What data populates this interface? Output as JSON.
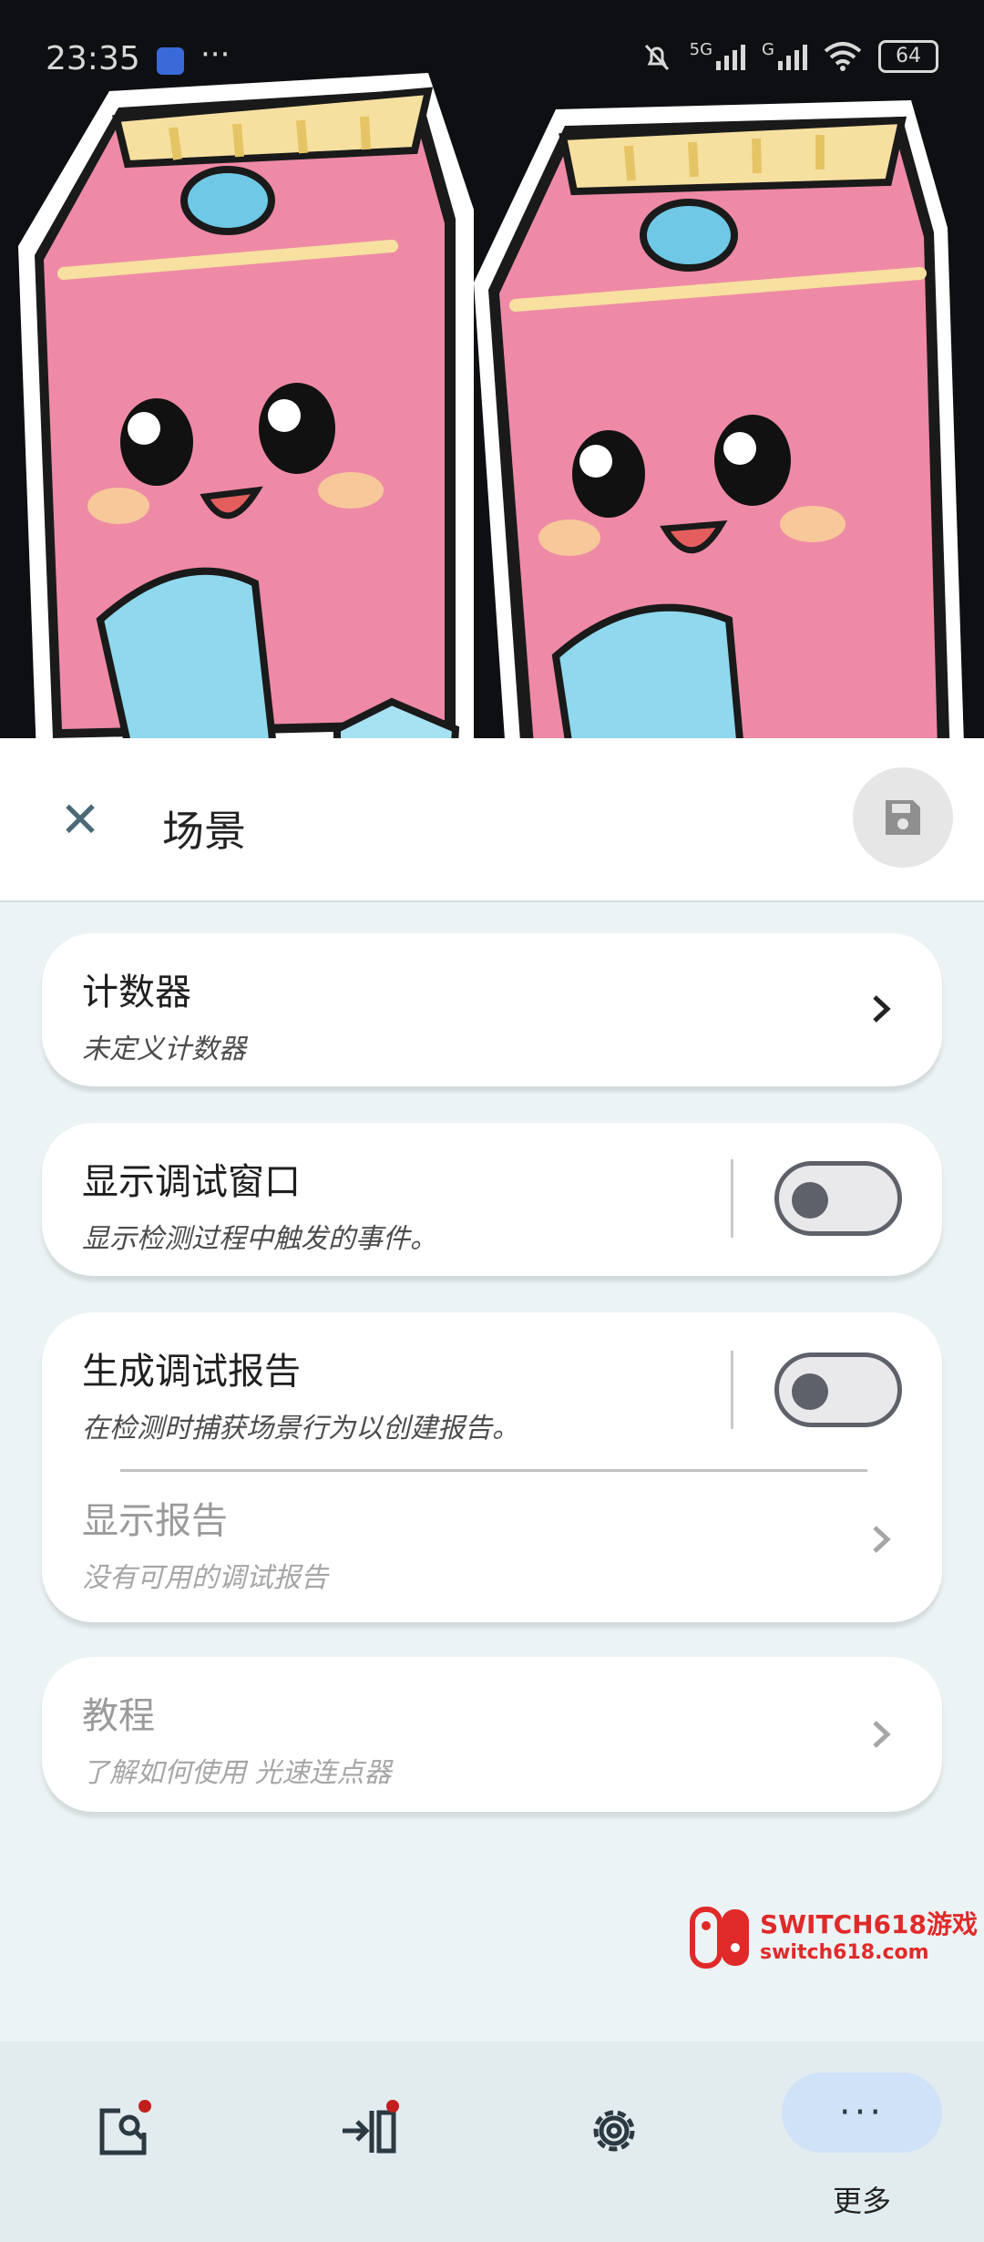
{
  "status_bar": {
    "time": "23:35",
    "more_dots": "···",
    "net_1": "5G",
    "net_2": "G",
    "battery": "64"
  },
  "header": {
    "title": "场景",
    "close_icon": "close-icon",
    "save_icon": "save-icon"
  },
  "cards": {
    "counter": {
      "title": "计数器",
      "subtitle": "未定义计数器"
    },
    "debug_window": {
      "title": "显示调试窗口",
      "subtitle": "显示检测过程中触发的事件。",
      "enabled": false
    },
    "debug_report": {
      "title": "生成调试报告",
      "subtitle": "在检测时捕获场景行为以创建报告。",
      "enabled": false
    },
    "show_report": {
      "title": "显示报告",
      "subtitle": "没有可用的调试报告"
    },
    "tutorial": {
      "title": "教程",
      "subtitle": "了解如何使用 光速连点器"
    }
  },
  "watermark": {
    "main": "SWITCH618游戏",
    "sub": "switch618.com"
  },
  "bottom_nav": {
    "more_dots": "···",
    "more_label": "更多"
  },
  "colors": {
    "accent_pill": "#cfe2f7",
    "badge": "#c31e1e",
    "background": "#ecf3f5"
  }
}
